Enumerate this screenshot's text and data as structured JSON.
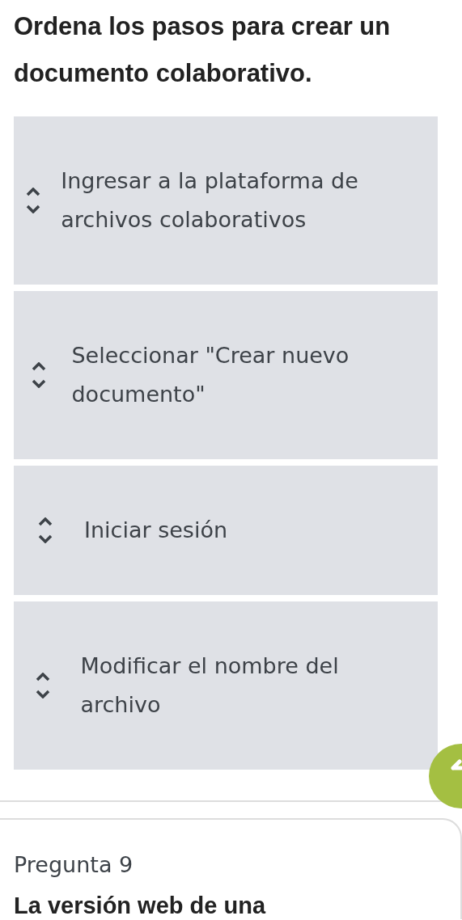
{
  "question": {
    "title": "Ordena los pasos para crear un documento colaborativo.",
    "items": [
      {
        "text": "Ingresar a la plataforma de archivos colaborativos"
      },
      {
        "text": "Seleccionar \"Crear nuevo documento\""
      },
      {
        "text": "Iniciar sesión"
      },
      {
        "text": "Modificar el nombre del archivo"
      }
    ]
  },
  "next_question": {
    "label": "Pregunta 9",
    "title": "La versión web de una"
  }
}
